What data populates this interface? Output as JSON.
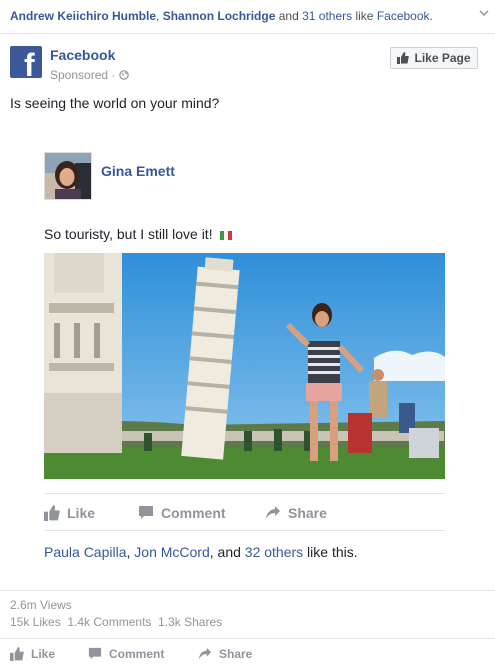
{
  "social_context": {
    "friend1": "Andrew Keiichiro Humble",
    "comma": ",",
    "friend2": "Shannon Lochridge",
    "and": " and ",
    "others": "31 others",
    "like_text": " like ",
    "page_link": "Facebook",
    "period": "."
  },
  "ad": {
    "page_name": "Facebook",
    "sponsored": "Sponsored",
    "dot": "·",
    "like_page": "Like Page",
    "text": "Is seeing the world on your mind?"
  },
  "embedded_post": {
    "author": "Gina Emett",
    "caption": "So touristy, but I still love it!",
    "actions": {
      "like": "Like",
      "comment": "Comment",
      "share": "Share"
    },
    "likers": {
      "name1": "Paula Capilla",
      "sep1": ", ",
      "name2": "Jon McCord",
      "sep2": ", and ",
      "others": "32 others",
      "tail": " like this."
    }
  },
  "stats": {
    "views": "2.6m Views",
    "likes": "15k Likes",
    "comments": "1.4k Comments",
    "shares": "1.3k Shares"
  },
  "actions": {
    "like": "Like",
    "comment": "Comment",
    "share": "Share"
  },
  "colors": {
    "link": "#365899",
    "brand": "#3b5998",
    "muted": "#90949c"
  }
}
